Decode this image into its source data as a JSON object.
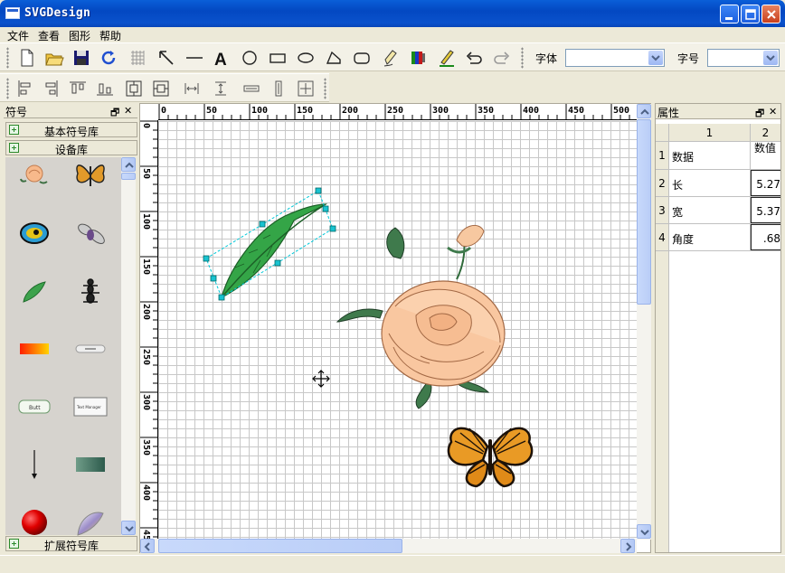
{
  "window": {
    "title": "SVGDesign"
  },
  "menu": [
    "文件",
    "查看",
    "图形",
    "帮助"
  ],
  "toolbar": {
    "font_label": "字体",
    "font_value": "",
    "size_label": "字号",
    "size_value": ""
  },
  "left_panel": {
    "title": "符号",
    "libraries": [
      {
        "label": "基本符号库",
        "expanded": false
      },
      {
        "label": "设备库",
        "expanded": true
      },
      {
        "label": "扩展符号库",
        "expanded": false
      }
    ],
    "symbol_buttons": [
      "Butt",
      "Text Manager"
    ]
  },
  "ruler": {
    "top": [
      "0",
      "50",
      "100",
      "150",
      "200",
      "250",
      "300",
      "350",
      "400",
      "450",
      "500"
    ],
    "left": [
      "0",
      "50",
      "100",
      "150",
      "200",
      "250",
      "300",
      "350",
      "400",
      "45"
    ]
  },
  "properties": {
    "title": "属性",
    "columns": [
      "1",
      "2"
    ],
    "rows": [
      {
        "index": "1",
        "name": "数据",
        "value": "数值"
      },
      {
        "index": "2",
        "name": "长",
        "value": "5.27"
      },
      {
        "index": "3",
        "name": "宽",
        "value": "5.37"
      },
      {
        "index": "4",
        "name": "角度",
        "value": ".68"
      }
    ]
  },
  "colors": {
    "titlebar": "#0348c2",
    "selection": "#00c8d8",
    "handle": "#19b3c5"
  }
}
